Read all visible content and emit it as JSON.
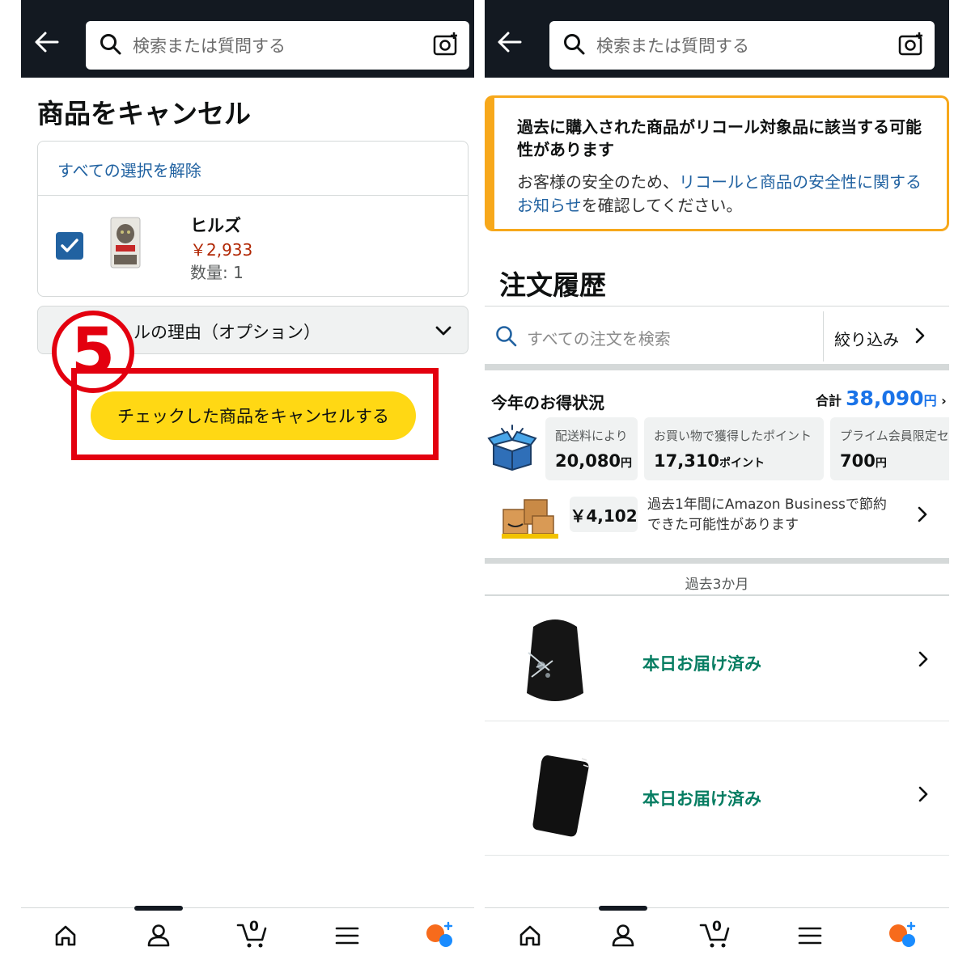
{
  "left": {
    "search_placeholder": "検索または質問する",
    "page_title": "商品をキャンセル",
    "deselect_all": "すべての選択を解除",
    "item": {
      "name": "ヒルズ",
      "price": "￥2,933",
      "qty": "数量: 1",
      "checked": true
    },
    "reason_dropdown": "ルの理由（オプション）",
    "step_number": "⑤",
    "cancel_button": "チェックした商品をキャンセルする",
    "cart_count": "0"
  },
  "right": {
    "search_placeholder": "検索または質問する",
    "recall": {
      "heading": "過去に購入された商品がリコール対象品に該当する可能性があります",
      "body_prefix": "お客様の安全のため、",
      "link": "リコールと商品の安全性に関するお知らせ",
      "body_suffix": "を確認してください。"
    },
    "orders_title": "注文履歴",
    "orders_search_placeholder": "すべての注文を検索",
    "filter_label": "絞り込み",
    "savings": {
      "title": "今年のお得状況",
      "total_label": "合計",
      "total_value": "38,090",
      "total_unit": "円",
      "stats": [
        {
          "label": "配送料により",
          "value": "20,080",
          "unit": "円"
        },
        {
          "label": "お買い物で獲得したポイント",
          "value": "17,310",
          "unit": "ポイント"
        },
        {
          "label": "プライム会員限定セ",
          "value": "700",
          "unit": "円"
        }
      ],
      "business_amount": "￥4,102",
      "business_text_line1": "過去1年間にAmazon Businessで節約",
      "business_text_line2": "できた可能性があります"
    },
    "period_label": "過去3か月",
    "orders": [
      {
        "status": "本日お届け済み"
      },
      {
        "status": "本日お届け済み"
      }
    ],
    "cart_count": "0"
  },
  "colors": {
    "topbar": "#131921",
    "accent_yellow": "#ffd814",
    "annotation_red": "#e3000f",
    "link_blue": "#2162a1",
    "delivered_green": "#067d62",
    "recall_border": "#f7a81b",
    "price_red": "#b12704"
  }
}
